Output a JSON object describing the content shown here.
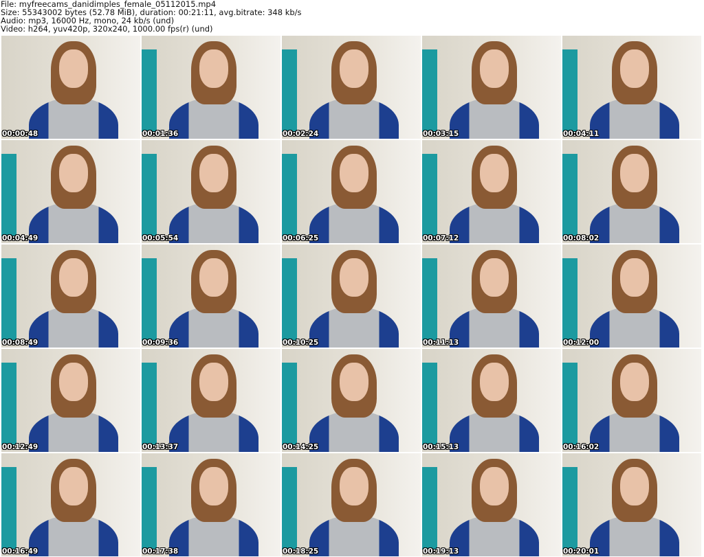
{
  "header": {
    "file": "File: myfreecams_danidimples_female_05112015.mp4",
    "size": "Size: 55343002 bytes (52.78 MiB), duration: 00:21:11, avg.bitrate: 348 kb/s",
    "audio": "Audio: mp3, 16000 Hz, mono, 24 kb/s (und)",
    "video": "Video: h264, yuv420p, 320x240, 1000.00 fps(r) (und)"
  },
  "thumbnails": [
    {
      "timestamp": "00:00:48"
    },
    {
      "timestamp": "00:01:36"
    },
    {
      "timestamp": "00:02:24"
    },
    {
      "timestamp": "00:03:15"
    },
    {
      "timestamp": "00:04:11"
    },
    {
      "timestamp": "00:04:49"
    },
    {
      "timestamp": "00:05:54"
    },
    {
      "timestamp": "00:06:25"
    },
    {
      "timestamp": "00:07:12"
    },
    {
      "timestamp": "00:08:02"
    },
    {
      "timestamp": "00:08:49"
    },
    {
      "timestamp": "00:09:36"
    },
    {
      "timestamp": "00:10:25"
    },
    {
      "timestamp": "00:11:13"
    },
    {
      "timestamp": "00:12:00"
    },
    {
      "timestamp": "00:12:49"
    },
    {
      "timestamp": "00:13:37"
    },
    {
      "timestamp": "00:14:25"
    },
    {
      "timestamp": "00:15:13"
    },
    {
      "timestamp": "00:16:02"
    },
    {
      "timestamp": "00:16:49"
    },
    {
      "timestamp": "00:17:38"
    },
    {
      "timestamp": "00:18:25"
    },
    {
      "timestamp": "00:19:13"
    },
    {
      "timestamp": "00:20:01"
    }
  ]
}
